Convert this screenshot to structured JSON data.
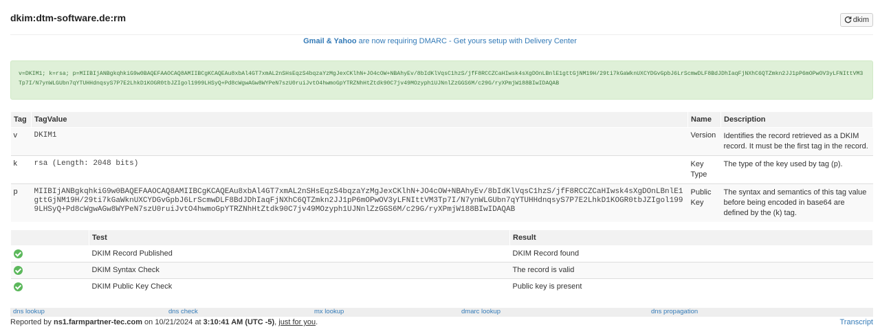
{
  "header": {
    "title": "dkim:dtm-software.de:rm",
    "refresh_label": "dkim"
  },
  "promo": {
    "brand": "Gmail & Yahoo",
    "text": " are now requiring DMARC - Get yours setup with Delivery Center"
  },
  "record": "v=DKIM1; k=rsa; p=MIIBIjANBgkqhkiG9w0BAQEFAAOCAQ8AMIIBCgKCAQEAu8xbAl4GT7xmAL2nSHsEqzS4bqzaYzMgJexCKlhN+JO4cOW+NBAhyEv/8bIdKlVqsC1hzS/jfF8RCCZCaHIwsk4sXgDOnLBnlE1gttGjNM19H/29ti7kGaWknUXCYDGvGpbJ6LrScmwDLF8BdJDhIaqFjNXhC6QTZmkn2JJ1pP6mOPwOV3yLFNIttVM3Tp7I/N7ynWLGUbn7qYTUHHdnqsyS7P7E2LhkD1KOGR0tbJZIgol1999LHSyQ+Pd8cWgwAGw8WYPeN7szU0ruiJvtO4hwmoGpYTRZNhHtZtdk90C7jv49MOzyph1UJNnlZzGGS6M/c29G/ryXPmjW188BIwIDAQAB",
  "tags_table": {
    "headers": [
      "Tag",
      "TagValue",
      "Name",
      "Description"
    ],
    "rows": [
      {
        "tag": "v",
        "value": "DKIM1",
        "name": "Version",
        "description": "Identifies the record retrieved as a DKIM record. It must be the first tag in the record."
      },
      {
        "tag": "k",
        "value": "rsa (Length: 2048 bits)",
        "name": "Key Type",
        "description": "The type of the key used by tag (p)."
      },
      {
        "tag": "p",
        "value": "MIIBIjANBgkqhkiG9w0BAQEFAAOCAQ8AMIIBCgKCAQEAu8xbAl4GT7xmAL2nSHsEqzS4bqzaYzMgJexCKlhN+JO4cOW+NBAhyEv/8bIdKlVqsC1hzS/jfF8RCCZCaHIwsk4sXgDOnLBnlE1gttGjNM19H/29ti7kGaWknUXCYDGvGpbJ6LrScmwDLF8BdJDhIaqFjNXhC6QTZmkn2JJ1pP6mOPwOV3yLFNIttVM3Tp7I/N7ynWLGUbn7qYTUHHdnqsyS7P7E2LhkD1KOGR0tbJZIgol1999LHSyQ+Pd8cWgwAGw8WYPeN7szU0ruiJvtO4hwmoGpYTRZNhHtZtdk90C7jv49MOzyph1UJNnlZzGGS6M/c29G/ryXPmjW188BIwIDAQAB",
        "name": "Public Key",
        "description": "The syntax and semantics of this tag value before being encoded in base64 are defined by the (k) tag."
      }
    ]
  },
  "tests_table": {
    "headers": [
      "",
      "Test",
      "Result"
    ],
    "rows": [
      {
        "status": "pass",
        "test": "DKIM Record Published",
        "result": "DKIM Record found"
      },
      {
        "status": "pass",
        "test": "DKIM Syntax Check",
        "result": "The record is valid"
      },
      {
        "status": "pass",
        "test": "DKIM Public Key Check",
        "result": "Public key is present"
      }
    ]
  },
  "links": [
    "dns lookup",
    "dns check",
    "mx lookup",
    "dmarc lookup",
    "dns propagation"
  ],
  "footer": {
    "prefix": "Reported by ",
    "server": "ns1.farmpartner-tec.com",
    "on": " on 10/21/2024 at ",
    "time": "3:10:41 AM (UTC -5)",
    "sep": ", ",
    "link": "just for you",
    "end": ".",
    "transcript": "Transcript"
  },
  "colors": {
    "accent": "#337ab7",
    "success_bg": "#dff0d8",
    "success_text": "#3c763d",
    "check": "#5cb85c"
  }
}
